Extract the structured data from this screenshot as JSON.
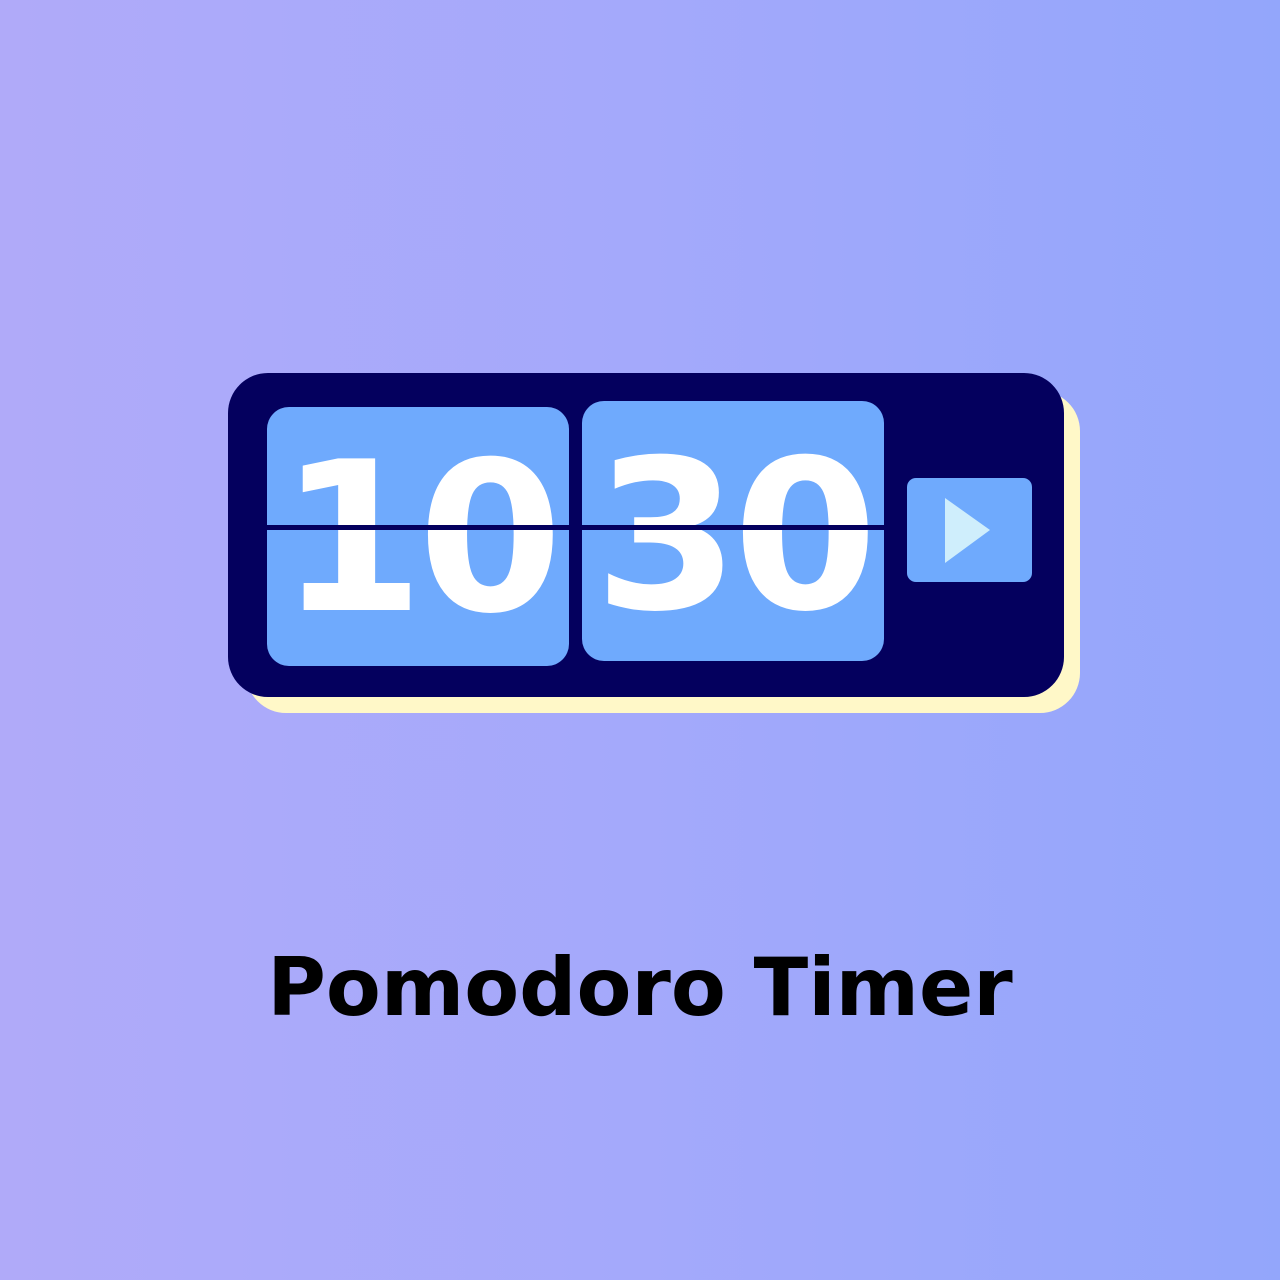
{
  "timer": {
    "hours": "10",
    "minutes": "30",
    "play_icon": "play-triangle-icon"
  },
  "caption": "Pomodoro Timer",
  "colors": {
    "background_start": "#b0aaf9",
    "background_end": "#93a6fb",
    "timer_body": "#04005e",
    "card": "#6faafd",
    "shadow": "#fff8c8",
    "digits": "#ffffff",
    "play_triangle": "#cfeefc"
  }
}
